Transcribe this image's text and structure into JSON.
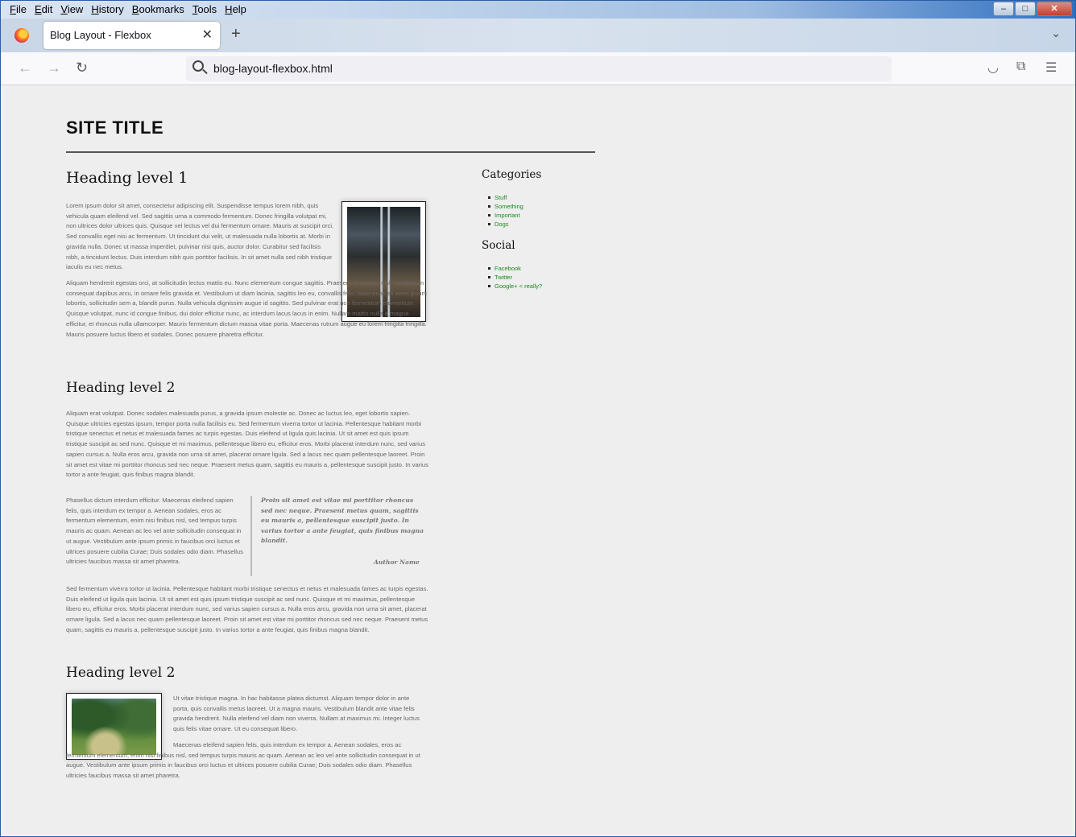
{
  "browser": {
    "menu": [
      "File",
      "Edit",
      "View",
      "History",
      "Bookmarks",
      "Tools",
      "Help"
    ],
    "window_controls": {
      "minimize": "–",
      "maximize": "□",
      "close": "✕"
    },
    "tab": {
      "title": "Blog Layout - Flexbox",
      "close": "✕"
    },
    "new_tab": "+",
    "tab_list": "⌄",
    "url": "blog-layout-flexbox.html",
    "nav": {
      "back": "←",
      "forward": "→",
      "reload": "↻",
      "pocket": "◡",
      "extensions": "⧉",
      "menu": "☰"
    }
  },
  "site": {
    "title": "SITE TITLE"
  },
  "main": {
    "section1": {
      "heading": "Heading level 1",
      "p1": "Lorem ipsum dolor sit amet, consectetur adipiscing elit. Suspendisse tempus lorem nibh, quis vehicula quam eleifend vel. Sed sagittis urna a commodo fermentum. Donec fringilla volutpat mi, non ultrices dolor ultrices quis. Quisque vel lectus vel dui fermentum ornare. Mauris at suscipit orci. Sed convallis eget nisi ac fermentum. Ut tincidunt dui velit, ut malesuada nulla lobortis at. Morbi in gravida nulla. Donec ut massa imperdiet, pulvinar nisi quis, auctor dolor. Curabitur sed facilisis nibh, a tincidunt lectus. Duis interdum nibh quis porttitor facilisis. In sit amet nulla sed nibh tristique iaculis eu nec metus.",
      "p2": "Aliquam hendrerit egestas orci, at sollicitudin lectus mattis eu. Nunc elementum congue sagittis. Praesent in tempus nisl. Vestibulum consequat dapibus arcu, in ornare felis gravida et. Vestibulum ut diam lacinia, sagittis leo eu, convallis felis. Maecenas sit amet ipsum lobortis, sollicitudin sem a, blandit purus. Nulla vehicula dignissim augue id sagittis. Sed pulvinar erat non fermentum elementum. Quisque volutpat, nunc id congue finibus, dui dolor efficitur nunc, ac interdum lacus lacus in enim. Nullam mattis nulla a magna efficitur, et rhoncus nulla ullamcorper. Mauris fermentum dictum massa vitae porta. Maecenas rutrum augue eu lorem fringilla fringilla. Mauris posuere luctus libero et sodales. Donec posuere pharetra efficitur."
    },
    "section2": {
      "heading": "Heading level 2",
      "p1": "Aliquam erat volutpat. Donec sodales malesuada purus, a gravida ipsum molestie ac. Donec ac luctus leo, eget lobortis sapien. Quisque ultricies egestas ipsum, tempor porta nulla facilisis eu. Sed fermentum viverra tortor ut lacinia. Pellentesque habitant morbi tristique senectus et netus et malesuada fames ac turpis egestas. Duis eleifend ut ligula quis lacinia. Ut sit amet est quis ipsum tristique suscipit ac sed nunc. Quisque et mi maximus, pellentesque libero eu, efficitur eros. Morbi placerat interdum nunc, sed varius sapien cursus a. Nulla eros arcu, gravida non urna sit amet, placerat ornare ligula. Sed a lacus nec quam pellentesque laoreet. Proin sit amet est vitae mi porttitor rhoncus sed nec neque. Praesent metus quam, sagittis eu mauris a, pellentesque suscipit justo. In varius tortor a ante feugiat, quis finibus magna blandit.",
      "p2": "Phasellus dictum interdum efficitur. Maecenas eleifend sapien felis, quis interdum ex tempor a. Aenean sodales, eros ac fermentum elementum, enim nisi finibus nisl, sed tempus turpis mauris ac quam. Aenean ac leo vel ante sollicitudin consequat in ut augue. Vestibulum ante ipsum primis in faucibus orci luctus et ultrices posuere cubilia Curae; Duis sodales odio diam. Phasellus ultricies faucibus massa sit amet pharetra.",
      "quote": "Proin sit amet est vitae mi porttitor rhoncus sed nec neque. Praesent metus quam, sagittis eu mauris a, pellentesque suscipit justo. In varius tortor a ante feugiat, quis finibus magna blandit.",
      "quote_author": "Author Name",
      "p3": "Sed fermentum viverra tortor ut lacinia. Pellentesque habitant morbi tristique senectus et netus et malesuada fames ac turpis egestas. Duis eleifend ut ligula quis lacinia. Ut sit amet est quis ipsum tristique suscipit ac sed nunc. Quisque et mi maximus, pellentesque libero eu, efficitur eros. Morbi placerat interdum nunc, sed varius sapien cursus a. Nulla eros arcu, gravida non urna sit amet, placerat ornare ligula. Sed a lacus nec quam pellentesque laoreet. Proin sit amet est vitae mi porttitor rhoncus sed nec neque. Praesent metus quam, sagittis eu mauris a, pellentesque suscipit justo. In varius tortor a ante feugiat, quis finibus magna blandit."
    },
    "section3": {
      "heading": "Heading level 2",
      "p1": "Ut vitae tristique magna. In hac habitasse platea dictumst. Aliquam tempor dolor in ante porta, quis convallis metus laoreet. Ut a magna mauris. Vestibulum blandit ante vitae felis gravida hendrerit. Nulla eleifend vel diam non viverra. Nullam at maximus mi. Integer luctus quis felis vitae ornare. Ut eu consequat libero.",
      "p2": "Maecenas eleifend sapien felis, quis interdum ex tempor a. Aenean sodales, eros ac fermentum elementum, enim nisi finibus nisl, sed tempus turpis mauris ac quam. Aenean ac leo vel ante sollicitudin consequat in ut augue. Vestibulum ante ipsum primis in faucibus orci luctus et ultrices posuere cubilia Curae; Duis sodales odio diam. Phasellus ultricies faucibus massa sit amet pharetra."
    }
  },
  "sidebar": {
    "categories_heading": "Categories",
    "categories": [
      "Stuff",
      "Something",
      "Important",
      "Dogs"
    ],
    "social_heading": "Social",
    "social": [
      "Facebook",
      "Twitter",
      "Google+ < really?"
    ]
  },
  "colors": {
    "link": "#1a8a1a",
    "text": "#666666",
    "page_bg": "#eeeeef"
  }
}
